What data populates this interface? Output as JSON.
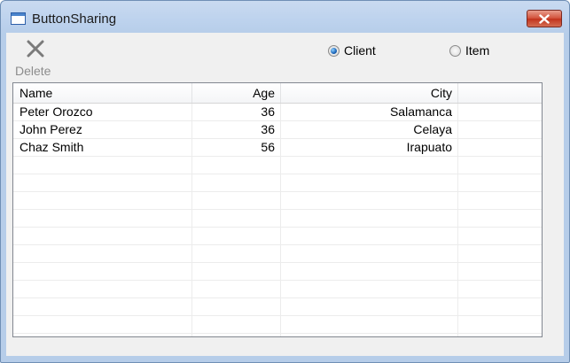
{
  "window": {
    "title": "ButtonSharing"
  },
  "toolbar": {
    "delete_label": "Delete"
  },
  "radios": [
    {
      "label": "Client",
      "checked": true
    },
    {
      "label": "Item",
      "checked": false
    }
  ],
  "grid": {
    "columns": [
      "Name",
      "Age",
      "City"
    ],
    "rows": [
      {
        "name": "Peter Orozco",
        "age": "36",
        "city": "Salamanca"
      },
      {
        "name": "John Perez",
        "age": "36",
        "city": "Celaya"
      },
      {
        "name": "Chaz Smith",
        "age": "56",
        "city": "Irapuato"
      }
    ]
  }
}
